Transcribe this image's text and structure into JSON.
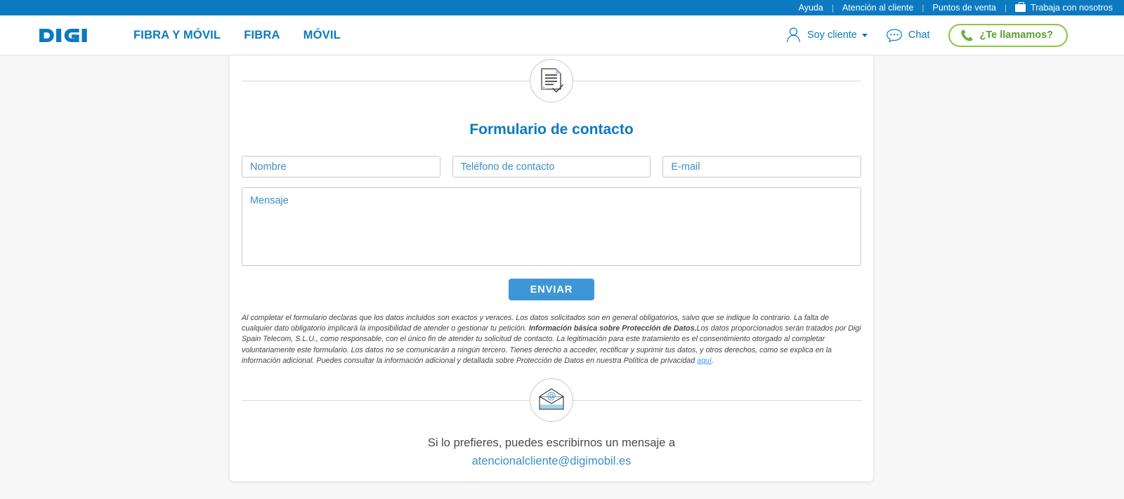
{
  "topbar": {
    "links": [
      {
        "label": "Ayuda",
        "icon": null
      },
      {
        "label": "Atención al cliente",
        "icon": null
      },
      {
        "label": "Puntos de venta",
        "icon": null
      },
      {
        "label": "Trabaja con nosotros",
        "icon": "briefcase-icon"
      }
    ],
    "separator": "|",
    "background": "#0b7ac0"
  },
  "header": {
    "logo_text": "DIGI",
    "nav": [
      {
        "label": "FIBRA Y MÓVIL"
      },
      {
        "label": "FIBRA"
      },
      {
        "label": "MÓVIL"
      }
    ],
    "customer": {
      "label": "Soy cliente",
      "icon": "user-icon"
    },
    "chat": {
      "label": "Chat",
      "icon": "chat-bubble-icon"
    },
    "callback": {
      "label": "¿Te llamamos?",
      "icon": "phone-icon"
    },
    "brand_color": "#0b7ac0",
    "accent_green": "#8cc63f"
  },
  "form": {
    "header_icon": "document-check-icon",
    "title": "Formulario de contacto",
    "fields": [
      {
        "name": "nombre",
        "placeholder": "Nombre",
        "value": ""
      },
      {
        "name": "telefono",
        "placeholder": "Teléfono de contacto",
        "value": ""
      },
      {
        "name": "email",
        "placeholder": "E-mail",
        "value": ""
      }
    ],
    "message": {
      "placeholder": "Mensaje",
      "value": ""
    },
    "submit_label": "ENVIAR",
    "submit_color": "#3e96d6",
    "legal": {
      "part1": "Al completar el formulario declaras que los datos incluidos son exactos y veraces. Los datos solicitados son en general obligatorios, salvo que se indique lo contrario. La falta de cualquier dato obligatorio implicará la imposibilidad de atender o gestionar tu petición. ",
      "bold": "Información básica sobre Protección de Datos.",
      "part2": "Los datos proporcionados serán tratados por Digi Spain Telecom, S.L.U., como responsable, con el único fin de atender tu solicitud de contacto. La legitimación para este tratamiento es el consentimiento otorgado al completar voluntariamente este formulario. Los datos no se comunicarán a ningún tercero. Tienes derecho a acceder, rectificar y suprimir tus datos, y otros derechos, como se explica en la información adicional. Puedes consultar la información adicional y detallada sobre Protección de Datos en nuestra Política de privacidad ",
      "link": "aquí",
      "part3": "."
    }
  },
  "contact": {
    "icon": "envelope-at-icon",
    "text": "Si lo prefieres, puedes escribirnos un mensaje a",
    "email": "atencionalcliente@digimobil.es"
  }
}
